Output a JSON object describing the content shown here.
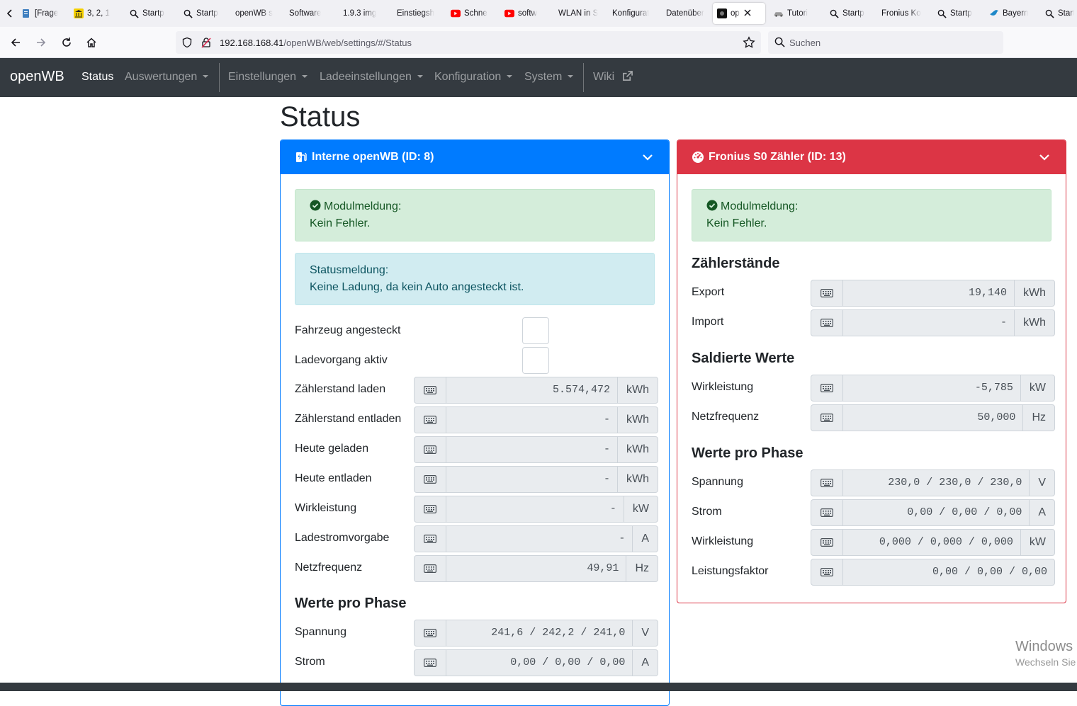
{
  "browser": {
    "tabs": [
      {
        "label": "[Frage",
        "icon": "document-icon"
      },
      {
        "label": "3, 2, 1",
        "icon": "bank-icon"
      },
      {
        "label": "Startp",
        "icon": "search-icon"
      },
      {
        "label": "Startp",
        "icon": "search-icon"
      },
      {
        "label": "openWB s",
        "icon": ""
      },
      {
        "label": "Software",
        "icon": ""
      },
      {
        "label": "1.9.3 img",
        "icon": ""
      },
      {
        "label": "Einstiegsh",
        "icon": ""
      },
      {
        "label": "Schne",
        "icon": "youtube-icon"
      },
      {
        "label": "softw",
        "icon": "youtube-icon"
      },
      {
        "label": "WLAN in S",
        "icon": ""
      },
      {
        "label": "Konfigurat",
        "icon": ""
      },
      {
        "label": "Datenüber",
        "icon": ""
      },
      {
        "label": "op",
        "icon": "site-icon"
      },
      {
        "label": "Tutori",
        "icon": "car-icon"
      },
      {
        "label": "Startp",
        "icon": "search-icon"
      },
      {
        "label": "Fronius Ko",
        "icon": ""
      },
      {
        "label": "Startp",
        "icon": "search-icon"
      },
      {
        "label": "Bayern",
        "icon": "bird-icon"
      },
      {
        "label": "Startp",
        "icon": "search-icon"
      }
    ],
    "url_host": "192.168.168.41",
    "url_path": "/openWB/web/settings/#/Status",
    "search_placeholder": "Suchen"
  },
  "nav": {
    "brand": "openWB",
    "items": [
      {
        "label": "Status",
        "dropdown": false,
        "active": true
      },
      {
        "label": "Auswertungen",
        "dropdown": true
      },
      {
        "label": "Einstellungen",
        "dropdown": true
      },
      {
        "label": "Ladeeinstellungen",
        "dropdown": true
      },
      {
        "label": "Konfiguration",
        "dropdown": true
      },
      {
        "label": "System",
        "dropdown": true
      },
      {
        "label": "Wiki",
        "dropdown": false
      }
    ]
  },
  "page_title": "Status",
  "left_card": {
    "title": "Interne openWB (ID: 8)",
    "color": "#007bff",
    "module_title": "Modulmeldung:",
    "module_text": "Kein Fehler.",
    "status_title": "Statusmeldung:",
    "status_text": "Keine Ladung, da kein Auto angesteckt ist.",
    "checkboxes": [
      {
        "label": "Fahrzeug angesteckt",
        "checked": false
      },
      {
        "label": "Ladevorgang aktiv",
        "checked": false
      }
    ],
    "rows": [
      {
        "label": "Zählerstand laden",
        "value": "5.574,472",
        "unit": "kWh"
      },
      {
        "label": "Zählerstand entladen",
        "value": "-",
        "unit": "kWh"
      },
      {
        "label": "Heute geladen",
        "value": "-",
        "unit": "kWh"
      },
      {
        "label": "Heute entladen",
        "value": "-",
        "unit": "kWh"
      },
      {
        "label": "Wirkleistung",
        "value": "-",
        "unit": "kW"
      },
      {
        "label": "Ladestromvorgabe",
        "value": "-",
        "unit": "A"
      },
      {
        "label": "Netzfrequenz",
        "value": "49,91",
        "unit": "Hz"
      }
    ],
    "phase_heading": "Werte pro Phase",
    "phase_rows": [
      {
        "label": "Spannung",
        "value": "241,6 / 242,2 / 241,0",
        "unit": "V"
      },
      {
        "label": "Strom",
        "value": "0,00 / 0,00 / 0,00",
        "unit": "A"
      }
    ]
  },
  "right_card": {
    "title": "Fronius S0 Zähler (ID: 13)",
    "color": "#dc3545",
    "module_title": "Modulmeldung:",
    "module_text": "Kein Fehler.",
    "sections": [
      {
        "heading": "Zählerstände",
        "rows": [
          {
            "label": "Export",
            "value": "19,140",
            "unit": "kWh"
          },
          {
            "label": "Import",
            "value": "-",
            "unit": "kWh"
          }
        ]
      },
      {
        "heading": "Saldierte Werte",
        "rows": [
          {
            "label": "Wirkleistung",
            "value": "-5,785",
            "unit": "kW"
          },
          {
            "label": "Netzfrequenz",
            "value": "50,000",
            "unit": "Hz"
          }
        ]
      },
      {
        "heading": "Werte pro Phase",
        "rows": [
          {
            "label": "Spannung",
            "value": "230,0 / 230,0 / 230,0",
            "unit": "V"
          },
          {
            "label": "Strom",
            "value": "0,00 / 0,00 / 0,00",
            "unit": "A"
          },
          {
            "label": "Wirkleistung",
            "value": "0,000 / 0,000 / 0,000",
            "unit": "kW"
          },
          {
            "label": "Leistungsfaktor",
            "value": "0,00 / 0,00 / 0,00",
            "unit": ""
          }
        ]
      }
    ]
  },
  "watermark": {
    "line1": "Windows",
    "line2": "Wechseln Sie"
  }
}
